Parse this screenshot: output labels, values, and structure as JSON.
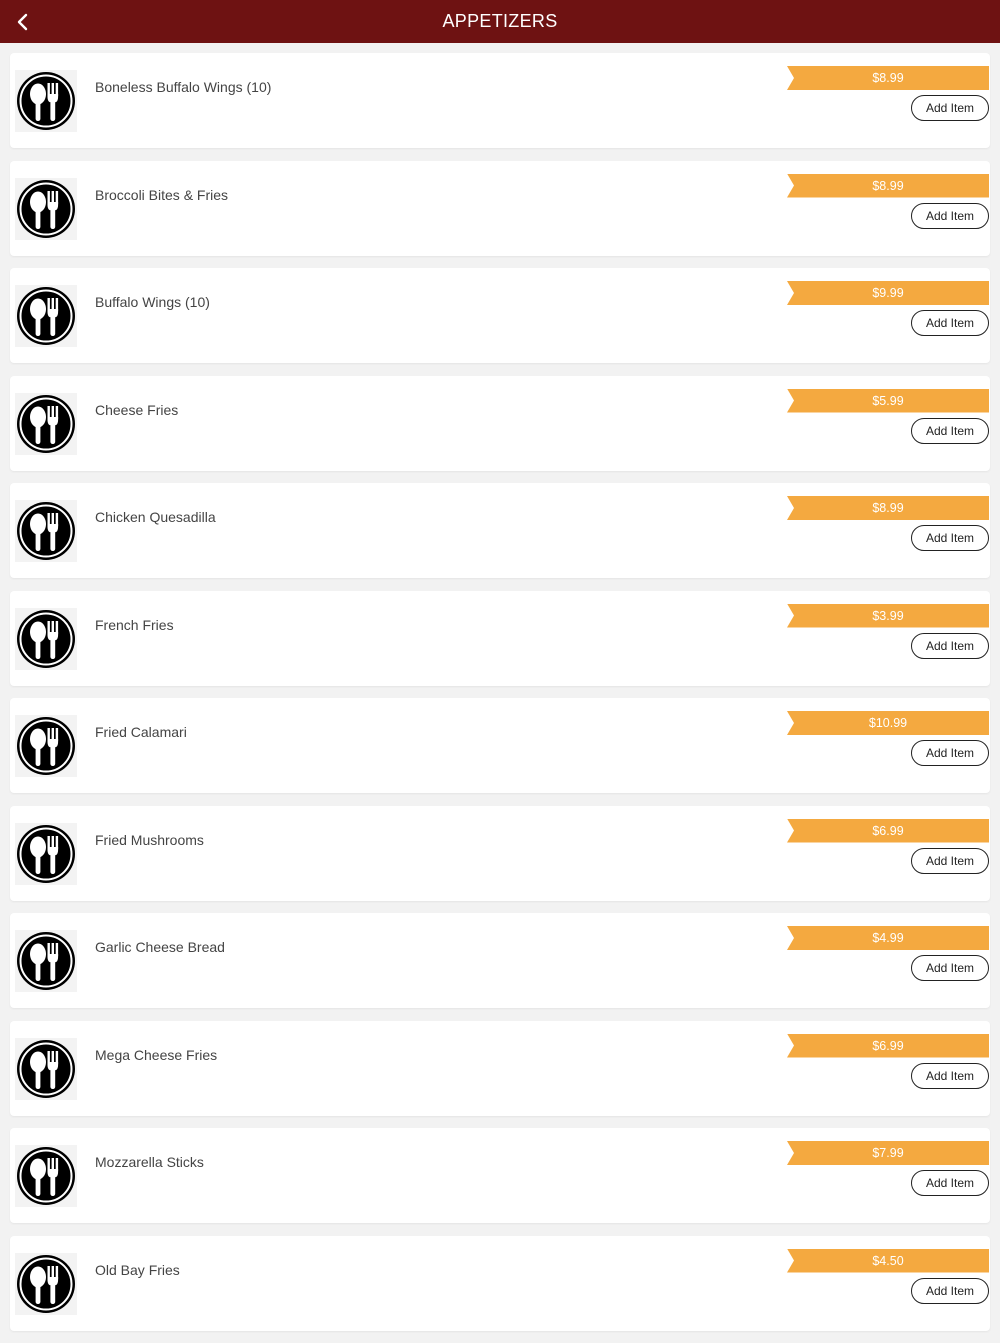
{
  "header": {
    "title": "APPETIZERS",
    "back_icon": "chevron-left-icon"
  },
  "colors": {
    "header_bg": "#6e1212",
    "price_bg": "#f4a940",
    "page_bg": "#f2f2f2"
  },
  "item_icon": "utensils-icon",
  "items": [
    {
      "name": "Boneless Buffalo Wings (10)",
      "price": "$8.99",
      "button": "Add Item"
    },
    {
      "name": "Broccoli Bites & Fries",
      "price": "$8.99",
      "button": "Add Item"
    },
    {
      "name": "Buffalo Wings (10)",
      "price": "$9.99",
      "button": "Add Item"
    },
    {
      "name": "Cheese Fries",
      "price": "$5.99",
      "button": "Add Item"
    },
    {
      "name": "Chicken Quesadilla",
      "price": "$8.99",
      "button": "Add Item"
    },
    {
      "name": "French Fries",
      "price": "$3.99",
      "button": "Add Item"
    },
    {
      "name": "Fried Calamari",
      "price": "$10.99",
      "button": "Add Item"
    },
    {
      "name": "Fried Mushrooms",
      "price": "$6.99",
      "button": "Add Item"
    },
    {
      "name": "Garlic Cheese Bread",
      "price": "$4.99",
      "button": "Add Item"
    },
    {
      "name": "Mega Cheese Fries",
      "price": "$6.99",
      "button": "Add Item"
    },
    {
      "name": "Mozzarella Sticks",
      "price": "$7.99",
      "button": "Add Item"
    },
    {
      "name": "Old Bay Fries",
      "price": "$4.50",
      "button": "Add Item"
    }
  ]
}
